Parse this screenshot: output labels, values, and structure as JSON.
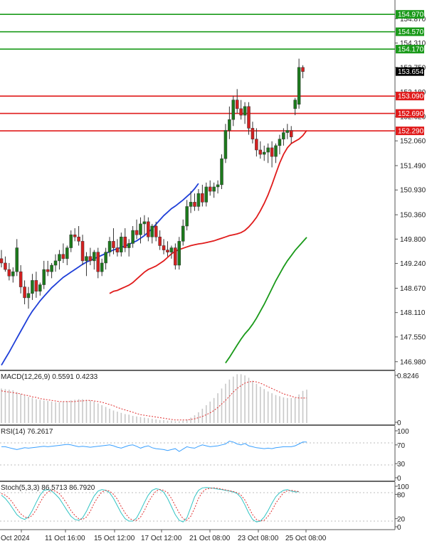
{
  "chart_data": {
    "type": "candlestick",
    "main": {
      "price_ticks": [
        "154.870",
        "154.310",
        "153.750",
        "153.180",
        "152.620",
        "152.060",
        "151.490",
        "150.930",
        "150.360",
        "149.800",
        "149.240",
        "148.670",
        "148.110",
        "147.550",
        "146.980"
      ],
      "hidden_ticks": [
        "154.870",
        "153.750",
        "152.620"
      ],
      "levels": [
        {
          "label": "154.970",
          "value": 154.97,
          "color": "#1a9a1a"
        },
        {
          "label": "154.570",
          "value": 154.57,
          "color": "#1a9a1a"
        },
        {
          "label": "154.170",
          "value": 154.17,
          "color": "#1a9a1a"
        },
        {
          "label": "153.090",
          "value": 153.09,
          "color": "#e01b1b"
        },
        {
          "label": "152.690",
          "value": 152.69,
          "color": "#e01b1b"
        },
        {
          "label": "152.290",
          "value": 152.29,
          "color": "#e01b1b"
        }
      ],
      "current_price": {
        "label": "153.654",
        "value": 153.654
      },
      "ylim": [
        146.78,
        155.3
      ],
      "ohlc": [
        [
          149.35,
          149.55,
          149.15,
          149.25
        ],
        [
          149.25,
          149.4,
          149.05,
          149.1
        ],
        [
          149.1,
          149.25,
          148.85,
          148.95
        ],
        [
          148.95,
          149.15,
          148.8,
          149.05
        ],
        [
          149.05,
          149.8,
          148.95,
          149.6
        ],
        [
          149.05,
          149.2,
          148.55,
          148.7
        ],
        [
          148.7,
          148.85,
          148.3,
          148.45
        ],
        [
          148.45,
          148.7,
          148.2,
          148.55
        ],
        [
          148.55,
          149.0,
          148.4,
          148.85
        ],
        [
          148.85,
          149.05,
          148.45,
          148.6
        ],
        [
          148.6,
          148.8,
          148.5,
          148.75
        ],
        [
          148.75,
          149.3,
          148.65,
          149.1
        ],
        [
          149.1,
          149.3,
          148.95,
          149.05
        ],
        [
          149.05,
          149.25,
          148.9,
          149.2
        ],
        [
          149.2,
          149.45,
          149.05,
          149.3
        ],
        [
          149.3,
          149.55,
          149.1,
          149.45
        ],
        [
          149.45,
          149.7,
          149.25,
          149.35
        ],
        [
          149.35,
          149.65,
          149.2,
          149.6
        ],
        [
          149.6,
          150.0,
          149.5,
          149.9
        ],
        [
          149.9,
          150.05,
          149.75,
          149.85
        ],
        [
          149.85,
          150.1,
          149.65,
          149.75
        ],
        [
          149.75,
          149.9,
          149.2,
          149.3
        ],
        [
          149.3,
          149.5,
          148.95,
          149.4
        ],
        [
          149.4,
          149.6,
          149.2,
          149.3
        ],
        [
          149.3,
          149.55,
          149.1,
          149.5
        ],
        [
          149.5,
          149.6,
          148.9,
          149.05
        ],
        [
          149.05,
          149.35,
          148.95,
          149.25
        ],
        [
          149.25,
          149.6,
          149.1,
          149.5
        ],
        [
          149.5,
          149.85,
          149.4,
          149.75
        ],
        [
          149.75,
          150.05,
          149.45,
          149.6
        ],
        [
          149.6,
          149.8,
          149.4,
          149.5
        ],
        [
          149.5,
          149.95,
          149.4,
          149.85
        ],
        [
          149.85,
          150.05,
          149.5,
          149.6
        ],
        [
          149.6,
          149.8,
          149.4,
          149.7
        ],
        [
          149.7,
          150.1,
          149.6,
          150.0
        ],
        [
          150.0,
          150.25,
          149.8,
          149.9
        ],
        [
          149.9,
          150.3,
          149.7,
          150.15
        ],
        [
          150.15,
          150.35,
          149.9,
          150.2
        ],
        [
          150.2,
          150.3,
          149.75,
          149.85
        ],
        [
          149.85,
          150.15,
          149.7,
          150.1
        ],
        [
          150.1,
          150.2,
          149.75,
          149.85
        ],
        [
          149.85,
          150.0,
          149.55,
          149.65
        ],
        [
          149.65,
          149.8,
          149.45,
          149.55
        ],
        [
          149.55,
          149.75,
          149.4,
          149.5
        ],
        [
          149.5,
          149.65,
          149.35,
          149.6
        ],
        [
          149.6,
          149.7,
          149.1,
          149.2
        ],
        [
          149.2,
          149.85,
          149.1,
          149.75
        ],
        [
          149.75,
          150.25,
          149.65,
          150.1
        ],
        [
          150.1,
          150.7,
          150.0,
          150.55
        ],
        [
          150.55,
          150.9,
          150.4,
          150.65
        ],
        [
          150.65,
          150.85,
          150.45,
          150.55
        ],
        [
          150.55,
          150.95,
          150.45,
          150.85
        ],
        [
          150.85,
          151.05,
          150.55,
          150.65
        ],
        [
          150.65,
          151.1,
          150.55,
          151.0
        ],
        [
          151.0,
          151.15,
          150.8,
          150.9
        ],
        [
          150.9,
          151.1,
          150.75,
          151.0
        ],
        [
          151.0,
          151.15,
          150.85,
          151.05
        ],
        [
          151.05,
          151.75,
          150.95,
          151.65
        ],
        [
          151.65,
          152.45,
          151.55,
          152.3
        ],
        [
          152.3,
          152.85,
          152.1,
          152.55
        ],
        [
          152.55,
          153.1,
          152.4,
          153.0
        ],
        [
          153.0,
          153.25,
          152.7,
          152.8
        ],
        [
          152.8,
          153.0,
          152.55,
          152.65
        ],
        [
          152.65,
          152.95,
          152.45,
          152.85
        ],
        [
          152.85,
          152.95,
          152.2,
          152.35
        ],
        [
          152.35,
          152.5,
          152.0,
          152.1
        ],
        [
          152.1,
          152.35,
          151.7,
          151.85
        ],
        [
          151.85,
          152.05,
          151.65,
          151.75
        ],
        [
          151.75,
          151.95,
          151.6,
          151.8
        ],
        [
          151.8,
          152.0,
          151.55,
          151.9
        ],
        [
          151.9,
          152.05,
          151.45,
          151.7
        ],
        [
          151.7,
          152.0,
          151.55,
          151.95
        ],
        [
          151.95,
          152.2,
          151.75,
          152.1
        ],
        [
          152.1,
          152.35,
          151.95,
          152.25
        ],
        [
          152.25,
          152.45,
          152.1,
          152.3
        ],
        [
          152.3,
          152.4,
          152.0,
          152.15
        ],
        [
          152.8,
          153.05,
          152.65,
          153.0
        ],
        [
          152.9,
          153.95,
          152.8,
          153.75
        ],
        [
          153.75,
          153.8,
          153.5,
          153.654
        ]
      ],
      "ma_red": [
        148.55,
        148.6,
        148.62,
        148.66,
        148.7,
        148.74,
        148.8,
        148.88,
        148.96,
        149.04,
        149.1,
        149.14,
        149.18,
        149.24,
        149.3,
        149.38,
        149.46,
        149.52,
        149.56,
        149.59,
        149.62,
        149.65,
        149.67,
        149.69,
        149.7,
        149.72,
        149.74,
        149.76,
        149.79,
        149.82,
        149.85,
        149.88,
        149.9,
        149.92,
        149.95,
        150.0,
        150.08,
        150.18,
        150.3,
        150.45,
        150.62,
        150.82,
        151.05,
        151.3,
        151.55,
        151.75,
        151.9,
        152.0,
        152.05,
        152.1,
        152.18,
        152.3
      ],
      "ma_red_start": 28,
      "ma_blue": [
        146.9,
        147.05,
        147.2,
        147.36,
        147.52,
        147.68,
        147.84,
        148.0,
        148.14,
        148.26,
        148.38,
        148.48,
        148.58,
        148.68,
        148.76,
        148.84,
        148.92,
        148.98,
        149.04,
        149.1,
        149.16,
        149.22,
        149.27,
        149.31,
        149.35,
        149.39,
        149.43,
        149.47,
        149.51,
        149.55,
        149.58,
        149.61,
        149.64,
        149.68,
        149.72,
        149.76,
        149.82,
        149.88,
        149.96,
        150.04,
        150.14,
        150.24,
        150.34,
        150.42,
        150.5,
        150.56,
        150.63,
        150.7,
        150.78,
        150.86,
        150.96,
        151.08
      ],
      "ma_blue_start": 28,
      "ma_green": [
        146.95,
        147.08,
        147.22,
        147.36,
        147.5,
        147.62,
        147.72,
        147.84,
        147.98,
        148.14,
        148.3,
        148.48,
        148.66,
        148.84,
        149.0,
        149.16,
        149.3,
        149.42,
        149.54,
        149.64,
        149.74,
        149.84
      ],
      "ma_green_start": 58
    },
    "macd": {
      "label": "MACD(12,26,9) 0.5591 0.4233",
      "ticks": [
        "0.8246",
        "0"
      ],
      "ymax": 0.8246,
      "hist": [
        0.58,
        0.57,
        0.56,
        0.55,
        0.52,
        0.49,
        0.46,
        0.44,
        0.42,
        0.4,
        0.39,
        0.38,
        0.37,
        0.36,
        0.35,
        0.35,
        0.36,
        0.37,
        0.38,
        0.39,
        0.4,
        0.4,
        0.39,
        0.38,
        0.36,
        0.33,
        0.3,
        0.27,
        0.24,
        0.21,
        0.19,
        0.17,
        0.15,
        0.14,
        0.12,
        0.11,
        0.1,
        0.09,
        0.08,
        0.07,
        0.06,
        0.05,
        0.05,
        0.04,
        0.04,
        0.03,
        0.03,
        0.04,
        0.06,
        0.09,
        0.13,
        0.18,
        0.24,
        0.3,
        0.36,
        0.42,
        0.5,
        0.58,
        0.66,
        0.73,
        0.78,
        0.82,
        0.82,
        0.8,
        0.76,
        0.71,
        0.66,
        0.61,
        0.57,
        0.53,
        0.5,
        0.47,
        0.45,
        0.43,
        0.42,
        0.42,
        0.42,
        0.48,
        0.54,
        0.56
      ],
      "signal": [
        0.54,
        0.53,
        0.52,
        0.51,
        0.5,
        0.49,
        0.47,
        0.46,
        0.44,
        0.43,
        0.41,
        0.4,
        0.39,
        0.38,
        0.37,
        0.36,
        0.36,
        0.36,
        0.36,
        0.36,
        0.37,
        0.37,
        0.38,
        0.38,
        0.37,
        0.36,
        0.35,
        0.33,
        0.31,
        0.29,
        0.26,
        0.24,
        0.22,
        0.2,
        0.18,
        0.16,
        0.14,
        0.13,
        0.12,
        0.11,
        0.1,
        0.09,
        0.08,
        0.07,
        0.06,
        0.05,
        0.05,
        0.05,
        0.05,
        0.06,
        0.07,
        0.09,
        0.11,
        0.14,
        0.17,
        0.21,
        0.26,
        0.32,
        0.38,
        0.45,
        0.52,
        0.58,
        0.63,
        0.67,
        0.69,
        0.7,
        0.69,
        0.67,
        0.64,
        0.61,
        0.58,
        0.55,
        0.52,
        0.49,
        0.47,
        0.45,
        0.43,
        0.42,
        0.42,
        0.42
      ]
    },
    "rsi": {
      "label": "RSI(14) 76.2617",
      "ticks": [
        {
          "label": "100",
          "value": 100
        },
        {
          "label": "70",
          "value": 70
        },
        {
          "label": "30",
          "value": 30
        },
        {
          "label": "0",
          "value": 0
        }
      ],
      "values": [
        66,
        66,
        64,
        62,
        60,
        62,
        64,
        63,
        64,
        65,
        66,
        67,
        66,
        67,
        68,
        69,
        70,
        71,
        70,
        68,
        66,
        67,
        66,
        65,
        66,
        67,
        68,
        69,
        70,
        68,
        65,
        63,
        66,
        69,
        70,
        67,
        63,
        66,
        68,
        64,
        62,
        61,
        60,
        58,
        60,
        62,
        56,
        61,
        66,
        64,
        63,
        67,
        70,
        68,
        66,
        67,
        68,
        70,
        72,
        78,
        76,
        72,
        70,
        73,
        68,
        66,
        64,
        63,
        62,
        63,
        62,
        64,
        65,
        66,
        66,
        66,
        68,
        72,
        76,
        76.26
      ]
    },
    "stoch": {
      "label": "Stoch(5,3,3) 86.5713 86.7920",
      "ticks": [
        {
          "label": "100",
          "value": 100
        },
        {
          "label": "80",
          "value": 80
        },
        {
          "label": "20",
          "value": 20
        },
        {
          "label": "0",
          "value": 0
        }
      ],
      "k": [
        78,
        70,
        58,
        44,
        30,
        22,
        18,
        24,
        40,
        60,
        78,
        90,
        92,
        88,
        80,
        70,
        55,
        40,
        26,
        18,
        16,
        22,
        38,
        58,
        76,
        88,
        92,
        90,
        84,
        70,
        52,
        34,
        20,
        14,
        14,
        22,
        40,
        60,
        78,
        90,
        94,
        92,
        85,
        70,
        50,
        30,
        16,
        12,
        22,
        48,
        74,
        90,
        96,
        97,
        96,
        95,
        93,
        92,
        90,
        88,
        86,
        82,
        72,
        54,
        34,
        18,
        12,
        14,
        24,
        40,
        58,
        74,
        84,
        90,
        92,
        88,
        86,
        86.57
      ],
      "d": [
        82,
        78,
        70,
        58,
        44,
        32,
        24,
        22,
        28,
        42,
        60,
        76,
        86,
        90,
        88,
        82,
        70,
        56,
        40,
        28,
        20,
        18,
        24,
        38,
        58,
        74,
        86,
        90,
        88,
        80,
        68,
        50,
        34,
        22,
        16,
        16,
        24,
        40,
        60,
        76,
        88,
        92,
        90,
        84,
        70,
        52,
        34,
        20,
        16,
        26,
        46,
        70,
        86,
        93,
        95,
        96,
        95,
        93,
        91,
        89,
        87,
        84,
        78,
        66,
        48,
        30,
        18,
        14,
        16,
        26,
        40,
        58,
        72,
        84,
        89,
        90,
        88,
        86.79
      ]
    },
    "x_labels": [
      "Oct 2024",
      "11 Oct 16:00",
      "15 Oct 12:00",
      "17 Oct 12:00",
      "21 Oct 08:00",
      "23 Oct 08:00",
      "25 Oct 08:00"
    ],
    "x_label_positions": [
      0,
      11,
      19,
      27,
      35,
      42,
      48
    ]
  }
}
